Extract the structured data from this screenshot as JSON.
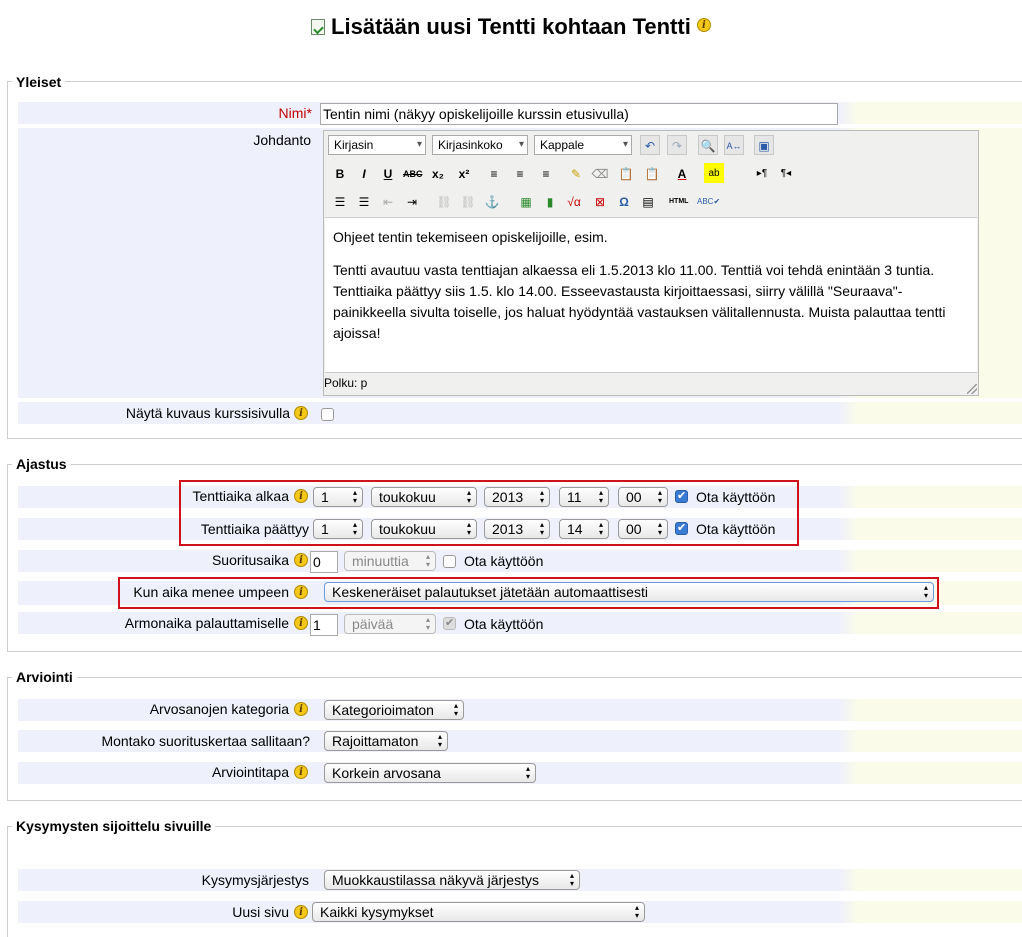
{
  "page": {
    "title": "Lisätään uusi Tentti kohtaan Tentti",
    "help_icon": "info-icon"
  },
  "general": {
    "legend": "Yleiset",
    "name_label": "Nimi",
    "required_mark": "*",
    "name_value": "Tentin nimi (näkyy opiskelijoille kurssin etusivulla)",
    "intro_label": "Johdanto",
    "editor": {
      "font_select": "Kirjasin",
      "size_select": "Kirjasinkoko",
      "format_select": "Kappale",
      "para1": "Ohjeet tentin tekemiseen opiskelijoille, esim.",
      "para2": "Tentti avautuu vasta tenttiajan alkaessa eli 1.5.2013 klo 11.00. Tenttiä voi tehdä enintään 3 tuntia. Tenttiaika päättyy siis 1.5. klo 14.00. Esseevastausta kirjoittaessasi, siirry välillä \"Seuraava\"-painikkeella sivulta toiselle, jos haluat hyödyntää vastauksen välitallennusta. Muista palauttaa tentti ajoissa!",
      "path": "Polku: p"
    },
    "show_desc_label": "Näytä kuvaus kurssisivulla"
  },
  "timing": {
    "legend": "Ajastus",
    "open_label": "Tenttiaika alkaa",
    "close_label": "Tenttiaika päättyy",
    "open": {
      "day": "1",
      "month": "toukokuu",
      "year": "2013",
      "hour": "11",
      "minute": "00"
    },
    "close": {
      "day": "1",
      "month": "toukokuu",
      "year": "2013",
      "hour": "14",
      "minute": "00"
    },
    "enable_label": "Ota käyttöön",
    "timelimit_label": "Suoritusaika",
    "timelimit_value": "0",
    "timelimit_unit": "minuuttia",
    "overdue_label": "Kun aika menee umpeen",
    "overdue_value": "Keskeneräiset palautukset jätetään automaattisesti",
    "grace_label": "Armonaika palauttamiselle",
    "grace_value": "1",
    "grace_unit": "päivää"
  },
  "grading": {
    "legend": "Arviointi",
    "category_label": "Arvosanojen kategoria",
    "category_value": "Kategorioimaton",
    "attempts_label": "Montako suorituskertaa sallitaan?",
    "attempts_value": "Rajoittamaton",
    "method_label": "Arviointitapa",
    "method_value": "Korkein arvosana"
  },
  "layout": {
    "legend": "Kysymysten sijoittelu sivuille",
    "order_label": "Kysymysjärjestys",
    "order_value": "Muokkaustilassa näkyvä järjestys",
    "newpage_label": "Uusi sivu",
    "newpage_value": "Kaikki kysymykset"
  },
  "colors": {
    "required": "#c00000",
    "highlight_border": "#d0121b",
    "label_bg": "#eef0fb",
    "field_bg": "#fbfbea"
  }
}
